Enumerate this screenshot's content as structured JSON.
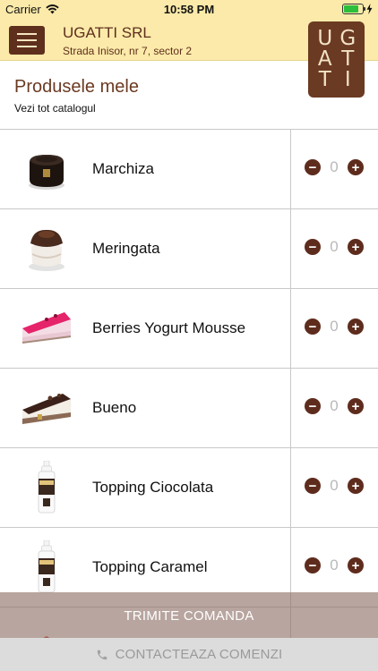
{
  "status_bar": {
    "carrier": "Carrier",
    "time": "10:58 PM",
    "battery_level": 0.8
  },
  "header": {
    "company_name": "UGATTI SRL",
    "address": "Strada Inisor, nr 7, sector 2",
    "logo_letters": [
      "U",
      "G",
      "A",
      "T",
      "T",
      "I"
    ]
  },
  "section": {
    "title": "Produsele mele",
    "link": "Vezi tot catalogul"
  },
  "products": [
    {
      "name": "Marchiza",
      "quantity": "0",
      "icon": "chocolate-cake-icon"
    },
    {
      "name": "Meringata",
      "quantity": "0",
      "icon": "meringue-cake-icon"
    },
    {
      "name": "Berries Yogurt Mousse",
      "quantity": "0",
      "icon": "berry-mousse-slice-icon"
    },
    {
      "name": "Bueno",
      "quantity": "0",
      "icon": "cheesecake-slice-icon"
    },
    {
      "name": "Topping Ciocolata",
      "quantity": "0",
      "icon": "topping-bottle-icon"
    },
    {
      "name": "Topping Caramel",
      "quantity": "0",
      "icon": "topping-bottle-icon"
    }
  ],
  "actions": {
    "submit": "TRIMITE COMANDA",
    "contact": "CONTACTEAZA COMENZI"
  },
  "colors": {
    "brand_brown": "#5f2f1d",
    "header_bg": "#fbeaa9",
    "submit_bar": "#8c6e64",
    "contact_bar": "#dcdcdc"
  }
}
